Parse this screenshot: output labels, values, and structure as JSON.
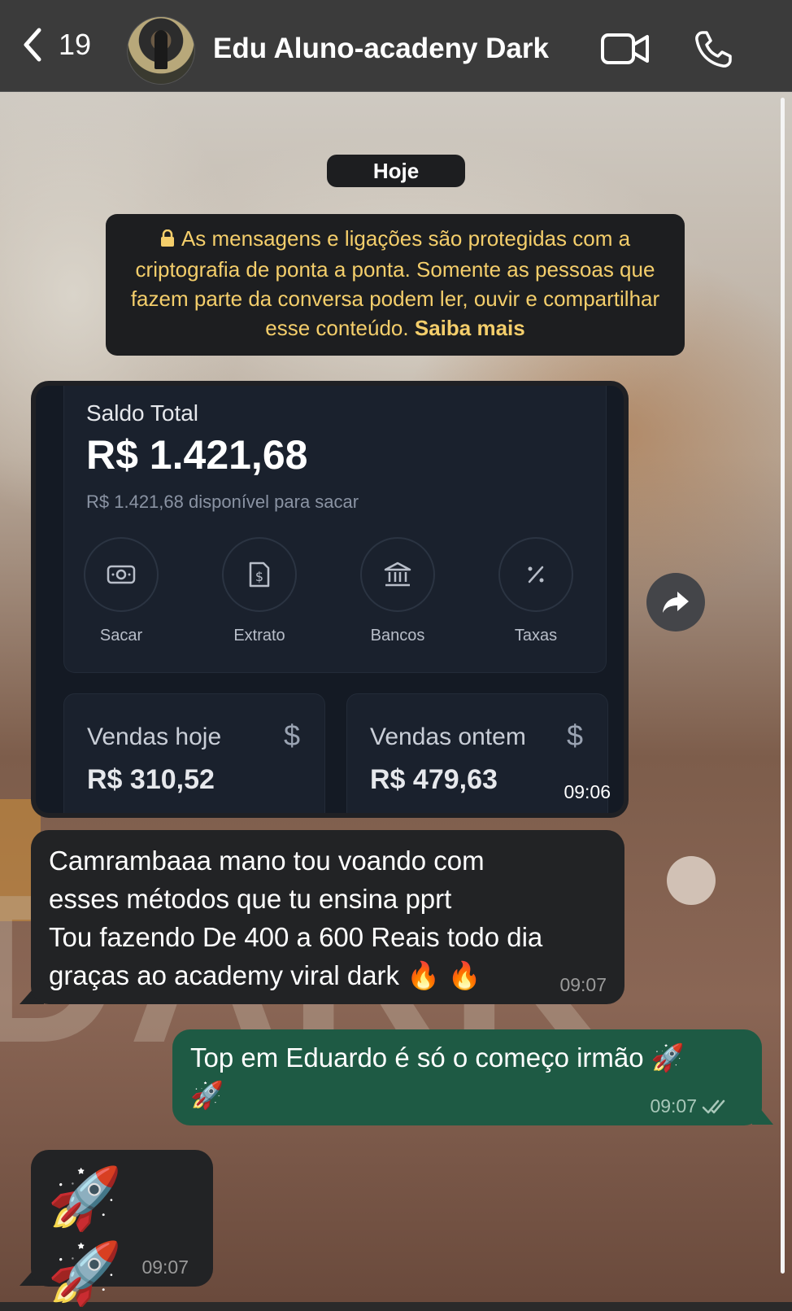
{
  "header": {
    "back_count": "19",
    "contact_name": "Edu Aluno-acadeny Dark"
  },
  "chat": {
    "date_label": "Hoje",
    "encryption_notice": "As mensagens e ligações são protegidas com a criptografia de ponta a ponta. Somente as pessoas que fazem parte da conversa podem ler, ouvir e compartilhar esse conteúdo.",
    "encryption_link": "Saiba mais"
  },
  "image_message": {
    "balance_title": "Saldo Total",
    "balance_value": "R$ 1.421,68",
    "balance_sub": "R$ 1.421,68 disponível para sacar",
    "actions": [
      {
        "label": "Sacar",
        "icon": "cash-icon"
      },
      {
        "label": "Extrato",
        "icon": "statement-icon"
      },
      {
        "label": "Bancos",
        "icon": "bank-icon"
      },
      {
        "label": "Taxas",
        "icon": "percent-icon"
      }
    ],
    "sales_today_label": "Vendas hoje",
    "sales_today_value": "R$ 310,52",
    "sales_yesterday_label": "Vendas ontem",
    "sales_yesterday_value": "R$ 479,63",
    "currency_symbol": "$",
    "time": "09:06"
  },
  "messages": {
    "incoming_text": "Camrambaaa mano tou voando com\nesses métodos que tu ensina pprt\nTou fazendo De 400 a 600 Reais todo dia\ngraças ao academy viral dark 🔥 🔥",
    "incoming_time": "09:07",
    "outgoing_text": "Top em Eduardo é só o começo irmão 🚀\n🚀",
    "outgoing_time": "09:07",
    "emoji_text": "🚀 🚀",
    "emoji_time": "09:07"
  },
  "colors": {
    "header_bg": "#3b3b3b",
    "incoming_bubble": "#222325",
    "outgoing_bubble": "#1e5a44",
    "encryption_text": "#f4ce6b"
  }
}
